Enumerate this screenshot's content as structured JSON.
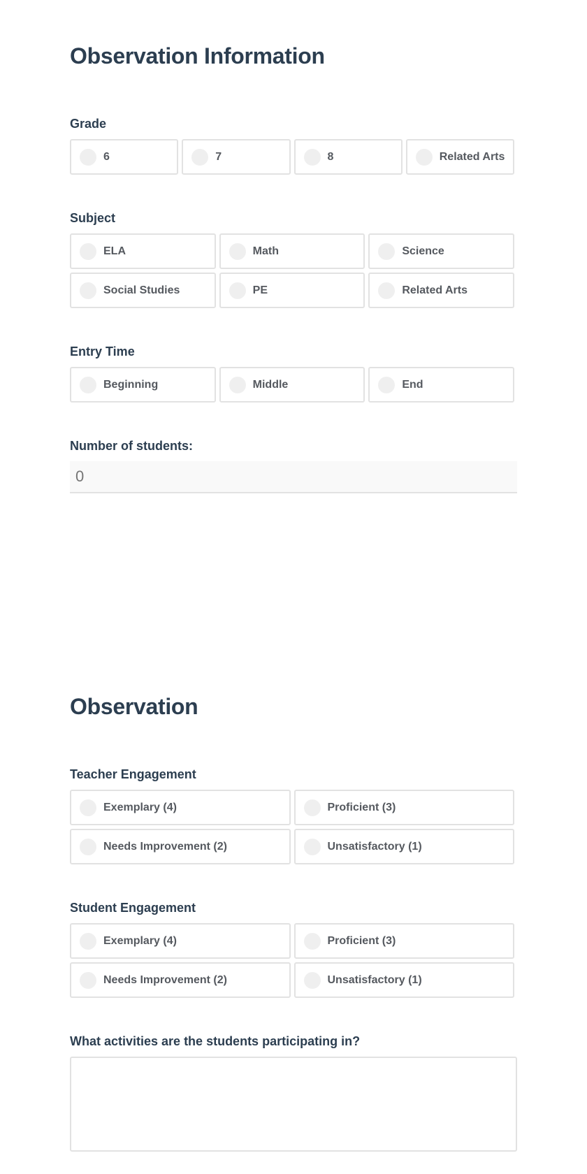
{
  "section1": {
    "title": "Observation Information",
    "grade": {
      "label": "Grade",
      "options": [
        "6",
        "7",
        "8",
        "Related Arts"
      ]
    },
    "subject": {
      "label": "Subject",
      "options": [
        "ELA",
        "Math",
        "Science",
        "Social Studies",
        "PE",
        "Related Arts"
      ]
    },
    "entry_time": {
      "label": "Entry Time",
      "options": [
        "Beginning",
        "Middle",
        "End"
      ]
    },
    "num_students": {
      "label": "Number of students:",
      "placeholder": "0"
    }
  },
  "section2": {
    "title": "Observation",
    "teacher_engagement": {
      "label": "Teacher Engagement",
      "options": [
        "Exemplary (4)",
        "Proficient (3)",
        "Needs Improvement (2)",
        "Unsatisfactory (1)"
      ]
    },
    "student_engagement": {
      "label": "Student Engagement",
      "options": [
        "Exemplary (4)",
        "Proficient (3)",
        "Needs Improvement (2)",
        "Unsatisfactory (1)"
      ]
    },
    "activities": {
      "label": "What activities are the students participating in?",
      "value": ""
    }
  }
}
